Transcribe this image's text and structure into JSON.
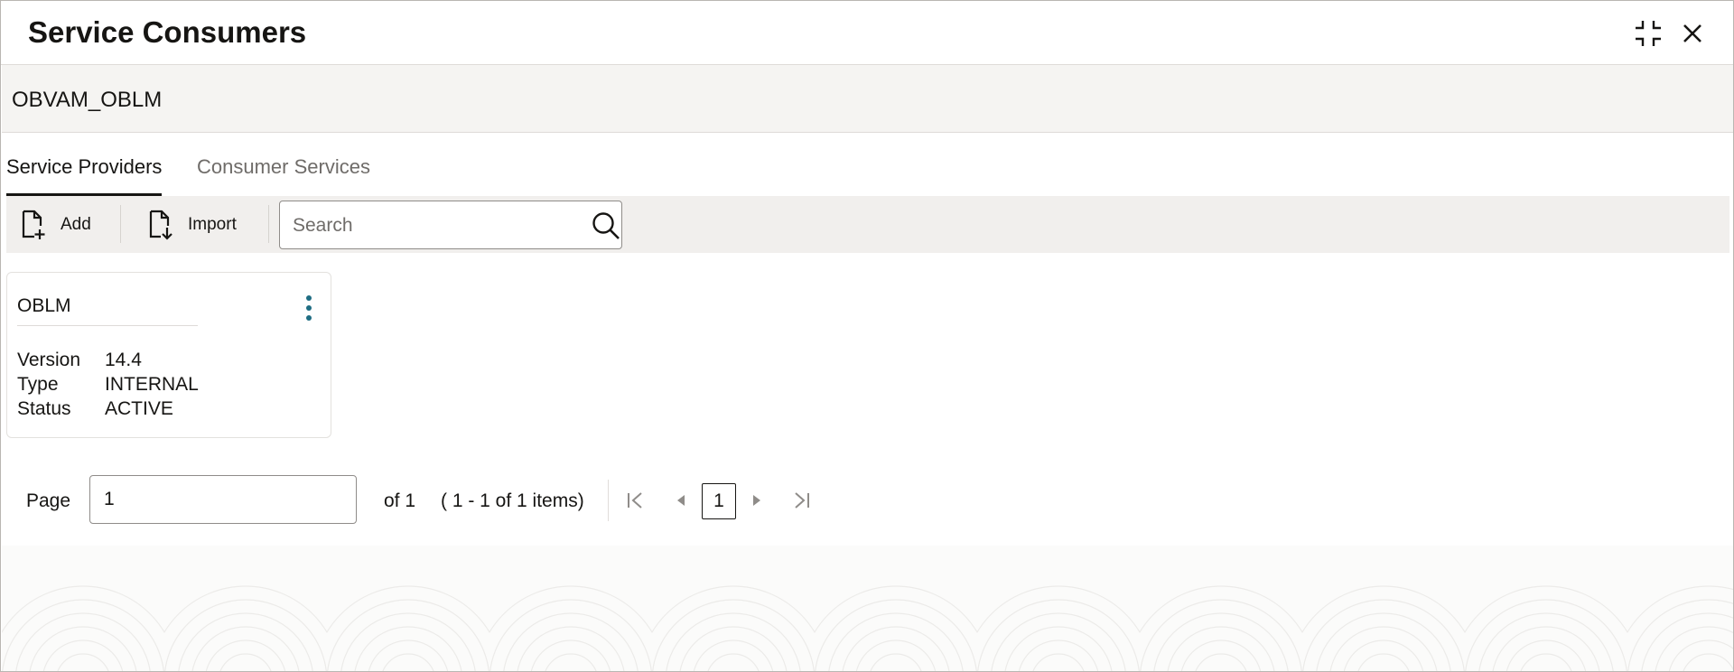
{
  "window": {
    "title": "Service Consumers"
  },
  "subheader": {
    "app_name": "OBVAM_OBLM"
  },
  "tabs": [
    {
      "label": "Service Providers",
      "active": true
    },
    {
      "label": "Consumer Services",
      "active": false
    }
  ],
  "toolbar": {
    "add_label": "Add",
    "import_label": "Import",
    "search_placeholder": "Search",
    "search_value": ""
  },
  "cards": [
    {
      "title": "OBLM",
      "properties": [
        {
          "label": "Version",
          "value": "14.4"
        },
        {
          "label": "Type",
          "value": "INTERNAL"
        },
        {
          "label": "Status",
          "value": "ACTIVE"
        }
      ]
    }
  ],
  "pagination": {
    "page_label": "Page",
    "page_value": "1",
    "of_text": "of 1",
    "items_text": "( 1 - 1 of 1 items)",
    "current_page": "1"
  },
  "icons": {
    "minimize": "minimize-icon",
    "close": "close-icon",
    "add": "add-document-icon",
    "import": "import-document-icon",
    "search": "search-icon",
    "more": "kebab-menu-icon",
    "first": "first-page-icon",
    "prev": "previous-page-icon",
    "next": "next-page-icon",
    "last": "last-page-icon"
  },
  "colors": {
    "accent_kebab": "#1f6d83",
    "toolbar_bg": "#f1efed",
    "subheader_bg": "#f5f4f2"
  }
}
